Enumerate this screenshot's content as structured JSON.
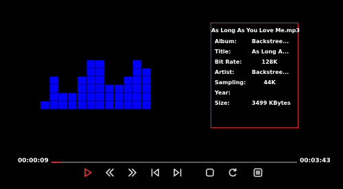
{
  "visualizer": {
    "bar_levels": [
      0,
      3,
      1,
      1,
      3,
      5,
      5,
      2,
      2,
      3,
      5,
      4
    ],
    "color": "#0000ff"
  },
  "info": {
    "title": "As Long As You Love Me.mp3",
    "rows": [
      {
        "key": "Album:",
        "value": "Backstree..."
      },
      {
        "key": "Title:",
        "value": "As Long A..."
      },
      {
        "key": "Bit Rate:",
        "value": "128K"
      },
      {
        "key": "Artist:",
        "value": "Backstree..."
      },
      {
        "key": "Sampling:",
        "value": "44K"
      },
      {
        "key": "Year:",
        "value": ""
      },
      {
        "key": "Size:",
        "value": "3499 KBytes"
      }
    ]
  },
  "playback": {
    "elapsed": "00:00:09",
    "total": "00:03:43",
    "progress": 0.04,
    "accent_color": "#d02a35"
  },
  "controls": [
    {
      "icon": "play-icon",
      "active": true
    },
    {
      "icon": "rewind-icon",
      "active": false
    },
    {
      "icon": "fast-forward-icon",
      "active": false
    },
    {
      "icon": "previous-track-icon",
      "active": false
    },
    {
      "icon": "next-track-icon",
      "active": false
    },
    {
      "icon": "stop-icon",
      "active": false
    },
    {
      "icon": "repeat-icon",
      "active": false
    },
    {
      "icon": "playlist-icon",
      "active": false
    }
  ]
}
